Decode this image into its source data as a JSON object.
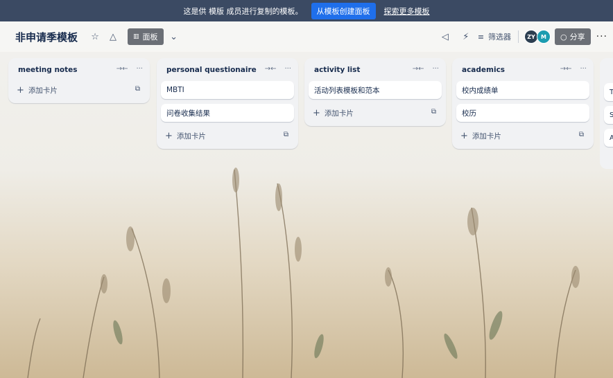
{
  "banner": {
    "message": "这是供 模版 成员进行复制的模板。",
    "create_button": "从模板创建面板",
    "explore_link": "探索更多模板"
  },
  "header": {
    "board_title": "非申请季模板",
    "view_label": "面板",
    "filter_label": "筛选器",
    "avatars": [
      "ZY",
      "M"
    ],
    "share_label": "分享"
  },
  "lists": [
    {
      "title": "meeting notes",
      "cards": [],
      "add_label": "添加卡片"
    },
    {
      "title": "personal questionaire",
      "cards": [
        "MBTI",
        "问卷收集结果"
      ],
      "add_label": "添加卡片"
    },
    {
      "title": "activity list",
      "cards": [
        "活动列表模板和范本"
      ],
      "add_label": "添加卡片"
    },
    {
      "title": "academics",
      "cards": [
        "校内成绩单",
        "校历"
      ],
      "add_label": "添加卡片"
    }
  ],
  "partial_list": {
    "card_initials": [
      "T",
      "S",
      "A"
    ]
  },
  "colors": {
    "banner_bg": "#3b4a63",
    "primary": "#1f6feb",
    "list_bg": "#f1f2f4"
  }
}
